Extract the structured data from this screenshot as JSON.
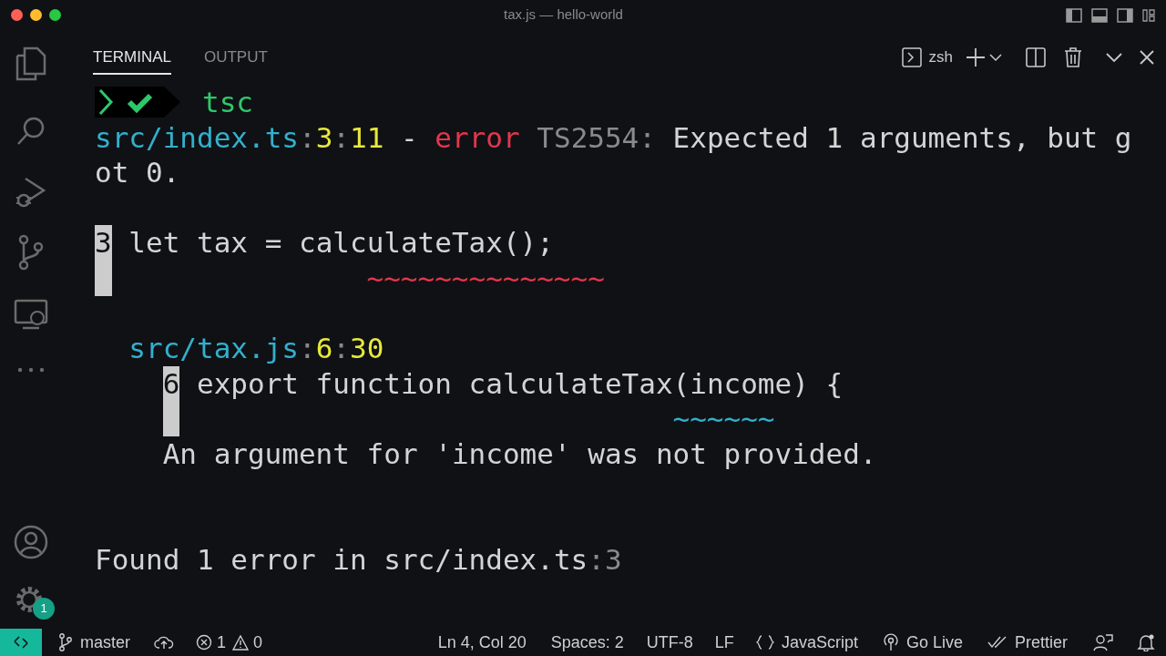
{
  "window": {
    "title": "tax.js — hello-world"
  },
  "panel_tabs": [
    {
      "label": "TERMINAL",
      "selected": true
    },
    {
      "label": "OUTPUT",
      "selected": false
    }
  ],
  "terminal_toolbar": {
    "shell": "zsh"
  },
  "activity_bar": {
    "badge": "1"
  },
  "terminal": {
    "lines": [
      {
        "kind": "prompt",
        "segments": [
          {
            "text": "tsc",
            "kind": "command"
          }
        ]
      },
      {
        "kind": "text",
        "segments": [
          {
            "text": "src/index.ts",
            "kind": "path"
          },
          {
            "text": ":",
            "kind": "punct"
          },
          {
            "text": "3",
            "kind": "position"
          },
          {
            "text": ":",
            "kind": "punct"
          },
          {
            "text": "11",
            "kind": "position"
          },
          {
            "text": " - ",
            "kind": "plain"
          },
          {
            "text": "error",
            "kind": "severity"
          },
          {
            "text": " TS2554:",
            "kind": "punct"
          },
          {
            "text": " Expected 1 arguments, but g",
            "kind": "plain"
          }
        ]
      },
      {
        "kind": "text",
        "segments": [
          {
            "text": "ot 0.",
            "kind": "plain"
          }
        ]
      },
      {
        "kind": "blank"
      },
      {
        "kind": "text",
        "segments": [
          {
            "text": "3",
            "kind": "line_number"
          },
          {
            "text": " let tax = calculateTax();",
            "kind": "plain"
          }
        ]
      },
      {
        "kind": "text",
        "segments": [
          {
            "kind": "line_marker"
          },
          {
            "text": "               ~~~~~~~~~~~~~~",
            "kind": "error_squiggle"
          }
        ]
      },
      {
        "kind": "blank"
      },
      {
        "kind": "detail",
        "segments": [
          {
            "text": "src/tax.js",
            "kind": "path"
          },
          {
            "text": ":",
            "kind": "punct"
          },
          {
            "text": "6",
            "kind": "position"
          },
          {
            "text": ":",
            "kind": "punct"
          },
          {
            "text": "30",
            "kind": "position"
          }
        ]
      },
      {
        "kind": "source",
        "segments": [
          {
            "text": "6",
            "kind": "line_number"
          },
          {
            "text": " export function calculateTax(income) {",
            "kind": "plain"
          }
        ]
      },
      {
        "kind": "source",
        "segments": [
          {
            "kind": "line_marker"
          },
          {
            "text": "                             ~~~~~~",
            "kind": "hint_squiggle"
          }
        ]
      },
      {
        "kind": "source",
        "segments": [
          {
            "text": "An argument for 'income' was not provided.",
            "kind": "plain"
          }
        ]
      },
      {
        "kind": "blank"
      },
      {
        "kind": "blank"
      },
      {
        "kind": "text",
        "segments": [
          {
            "text": "Found 1 error in src/index.ts",
            "kind": "plain"
          },
          {
            "text": ":3",
            "kind": "punct"
          }
        ]
      }
    ]
  },
  "status_bar": {
    "branch": "master",
    "errors": "1",
    "warnings": "0",
    "items": [
      "Ln 4, Col 20",
      "Spaces: 2",
      "UTF-8",
      "LF",
      "JavaScript",
      "Go Live",
      "Prettier"
    ]
  }
}
